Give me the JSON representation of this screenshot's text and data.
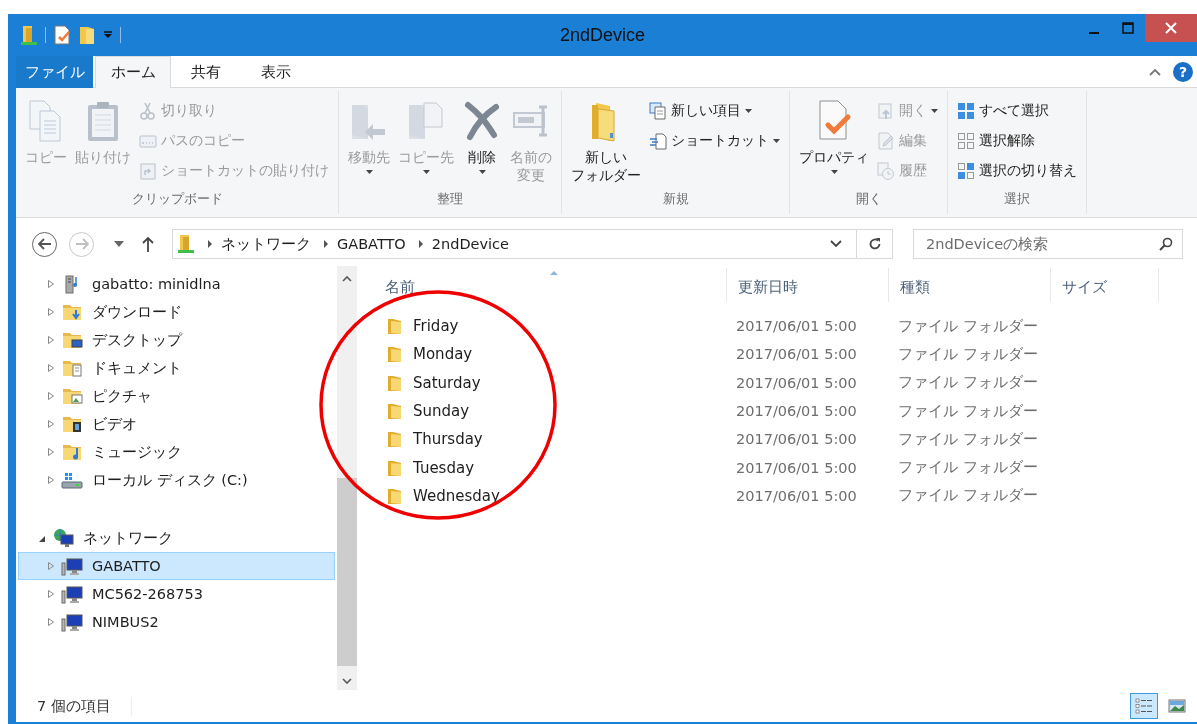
{
  "window": {
    "title": "2ndDevice"
  },
  "ribbon_tabs": [
    {
      "label": "ファイル",
      "kind": "file",
      "selected": false
    },
    {
      "label": "ホーム",
      "kind": "tab",
      "selected": true
    },
    {
      "label": "共有",
      "kind": "tab",
      "selected": false
    },
    {
      "label": "表示",
      "kind": "tab",
      "selected": false
    }
  ],
  "help_button": {
    "label": "?"
  },
  "ribbon_groups": [
    {
      "label": "クリップボード",
      "columns": [
        [
          {
            "label": [
              "コピー"
            ],
            "kind": "large",
            "disabled": true,
            "menu": false
          }
        ],
        [
          {
            "label": [
              "貼り付け"
            ],
            "kind": "large",
            "disabled": true,
            "menu": false
          }
        ],
        [
          {
            "label": [
              "切り取り"
            ],
            "kind": "small",
            "disabled": true,
            "menu": false
          },
          {
            "label": [
              "パスのコピー"
            ],
            "kind": "small",
            "disabled": true,
            "menu": false
          },
          {
            "label": [
              "ショートカットの貼り付け"
            ],
            "kind": "small",
            "disabled": true,
            "menu": false
          }
        ]
      ]
    },
    {
      "label": "整理",
      "columns": [
        [
          {
            "label": [
              "移動先"
            ],
            "kind": "large",
            "disabled": true,
            "menu": true
          }
        ],
        [
          {
            "label": [
              "コピー先"
            ],
            "kind": "large",
            "disabled": true,
            "menu": true
          }
        ],
        [
          {
            "label": [
              "削除"
            ],
            "kind": "large",
            "disabled": false,
            "menu": true
          }
        ],
        [
          {
            "label": [
              "名前の",
              "変更"
            ],
            "kind": "large",
            "disabled": true,
            "menu": false
          }
        ]
      ]
    },
    {
      "label": "新規",
      "columns": [
        [
          {
            "label": [
              "新しい",
              "フォルダー"
            ],
            "kind": "large",
            "disabled": false,
            "menu": false
          }
        ],
        [
          {
            "label": [
              "新しい項目"
            ],
            "kind": "small",
            "disabled": false,
            "menu": true
          },
          {
            "label": [
              "ショートカット"
            ],
            "kind": "small",
            "disabled": false,
            "menu": true
          }
        ]
      ]
    },
    {
      "label": "開く",
      "columns": [
        [
          {
            "label": [
              "プロパティ"
            ],
            "kind": "large",
            "disabled": false,
            "menu": true
          }
        ],
        [
          {
            "label": [
              "開く"
            ],
            "kind": "small",
            "disabled": true,
            "menu": true
          },
          {
            "label": [
              "編集"
            ],
            "kind": "small",
            "disabled": true,
            "menu": false
          },
          {
            "label": [
              "履歴"
            ],
            "kind": "small",
            "disabled": true,
            "menu": false
          }
        ]
      ]
    },
    {
      "label": "選択",
      "columns": [
        [
          {
            "label": [
              "すべて選択"
            ],
            "kind": "small",
            "disabled": false,
            "menu": false
          },
          {
            "label": [
              "選択解除"
            ],
            "kind": "small",
            "disabled": false,
            "menu": false
          },
          {
            "label": [
              "選択の切り替え"
            ],
            "kind": "small",
            "disabled": false,
            "menu": false
          }
        ]
      ]
    }
  ],
  "navigation": {
    "back": {
      "disabled": false
    },
    "forward": {
      "disabled": true
    }
  },
  "address_bar": {
    "path": [
      "ネットワーク",
      "GABATTO",
      "2ndDevice"
    ]
  },
  "search": {
    "placeholder": "2ndDeviceの検索"
  },
  "nav_tree": [
    {
      "children": [
        {
          "label": "gabatto: minidlna",
          "kind": "media-server",
          "expanded": false,
          "selected": false
        },
        {
          "label": "ダウンロード",
          "kind": "downloads",
          "expanded": false,
          "selected": false
        },
        {
          "label": "デスクトップ",
          "kind": "desktop",
          "expanded": false,
          "selected": false
        },
        {
          "label": "ドキュメント",
          "kind": "documents",
          "expanded": false,
          "selected": false
        },
        {
          "label": "ピクチャ",
          "kind": "pictures",
          "expanded": false,
          "selected": false
        },
        {
          "label": "ビデオ",
          "kind": "videos",
          "expanded": false,
          "selected": false
        },
        {
          "label": "ミュージック",
          "kind": "music",
          "expanded": false,
          "selected": false
        },
        {
          "label": "ローカル ディスク (C:)",
          "kind": "drive",
          "expanded": false,
          "selected": false
        }
      ]
    },
    {
      "label": "ネットワーク",
      "kind": "network",
      "expanded": true,
      "selected": false,
      "children": [
        {
          "label": "GABATTO",
          "kind": "computer",
          "expanded": false,
          "selected": true
        },
        {
          "label": "MC562-268753",
          "kind": "computer",
          "expanded": false,
          "selected": false
        },
        {
          "label": "NIMBUS2",
          "kind": "computer",
          "expanded": false,
          "selected": false
        }
      ]
    }
  ],
  "file_list": {
    "columns": [
      {
        "label": "名前",
        "sorted": true
      },
      {
        "label": "更新日時",
        "sorted": false
      },
      {
        "label": "種類",
        "sorted": false
      },
      {
        "label": "サイズ",
        "sorted": false
      }
    ],
    "rows": [
      {
        "name": "Friday",
        "modified": "2017/06/01 5:00",
        "type": "ファイル フォルダー"
      },
      {
        "name": "Monday",
        "modified": "2017/06/01 5:00",
        "type": "ファイル フォルダー"
      },
      {
        "name": "Saturday",
        "modified": "2017/06/01 5:00",
        "type": "ファイル フォルダー"
      },
      {
        "name": "Sunday",
        "modified": "2017/06/01 5:00",
        "type": "ファイル フォルダー"
      },
      {
        "name": "Thursday",
        "modified": "2017/06/01 5:00",
        "type": "ファイル フォルダー"
      },
      {
        "name": "Tuesday",
        "modified": "2017/06/01 5:00",
        "type": "ファイル フォルダー"
      },
      {
        "name": "Wednesday",
        "modified": "2017/06/01 5:00",
        "type": "ファイル フォルダー"
      }
    ]
  },
  "status_bar": {
    "item_count": "7 個の項目"
  },
  "view_buttons": [
    {
      "kind": "details",
      "selected": true
    },
    {
      "kind": "large-icons",
      "selected": false
    }
  ],
  "annotation": {
    "kind": "circle"
  }
}
